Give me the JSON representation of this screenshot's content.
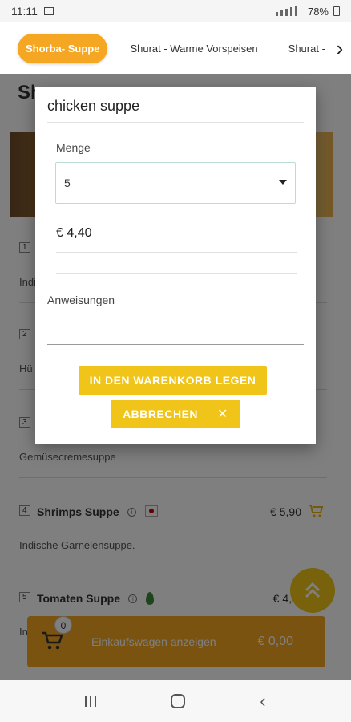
{
  "status_bar": {
    "time": "11:11",
    "battery": "78%"
  },
  "tabs": [
    {
      "label": "Shorba- Suppe",
      "active": true
    },
    {
      "label": "Shurat - Warme Vorspeisen",
      "active": false
    },
    {
      "label": "Shurat - K",
      "active": false
    }
  ],
  "background": {
    "section_title": "Sh",
    "dishes": [
      {
        "num": "1",
        "name": "",
        "desc": "Indi",
        "price": ""
      },
      {
        "num": "2",
        "name": "",
        "desc": "Hü",
        "price": ""
      },
      {
        "num": "3",
        "name": "",
        "desc": "Gemüsecremesuppe",
        "price": ""
      },
      {
        "num": "4",
        "name": "Shrimps Suppe",
        "desc": "Indische Garnelensuppe.",
        "price": "€ 5,90"
      },
      {
        "num": "5",
        "name": "Tomaten Suppe",
        "desc": "In",
        "price": "€ 4,"
      }
    ],
    "cart_bar": {
      "count": "0",
      "label": "Einkaufswagen anzeigen",
      "total": "€ 0,00"
    }
  },
  "modal": {
    "title": "chicken suppe",
    "quantity_label": "Menge",
    "quantity_value": "5",
    "price": "€ 4,40",
    "instructions_label": "Anweisungen",
    "instructions_value": "",
    "add_button": "IN DEN WARENKORB LEGEN",
    "cancel_button": "ABBRECHEN",
    "accent_color": "#f0c419"
  },
  "colors": {
    "brand_orange": "#f5a623",
    "accent_yellow": "#f0c419"
  },
  "icons": {
    "tab_next": "chevron-right-icon",
    "cart": "shopping-cart-icon",
    "scroll_top": "double-chevron-up-icon",
    "close": "close-icon"
  }
}
